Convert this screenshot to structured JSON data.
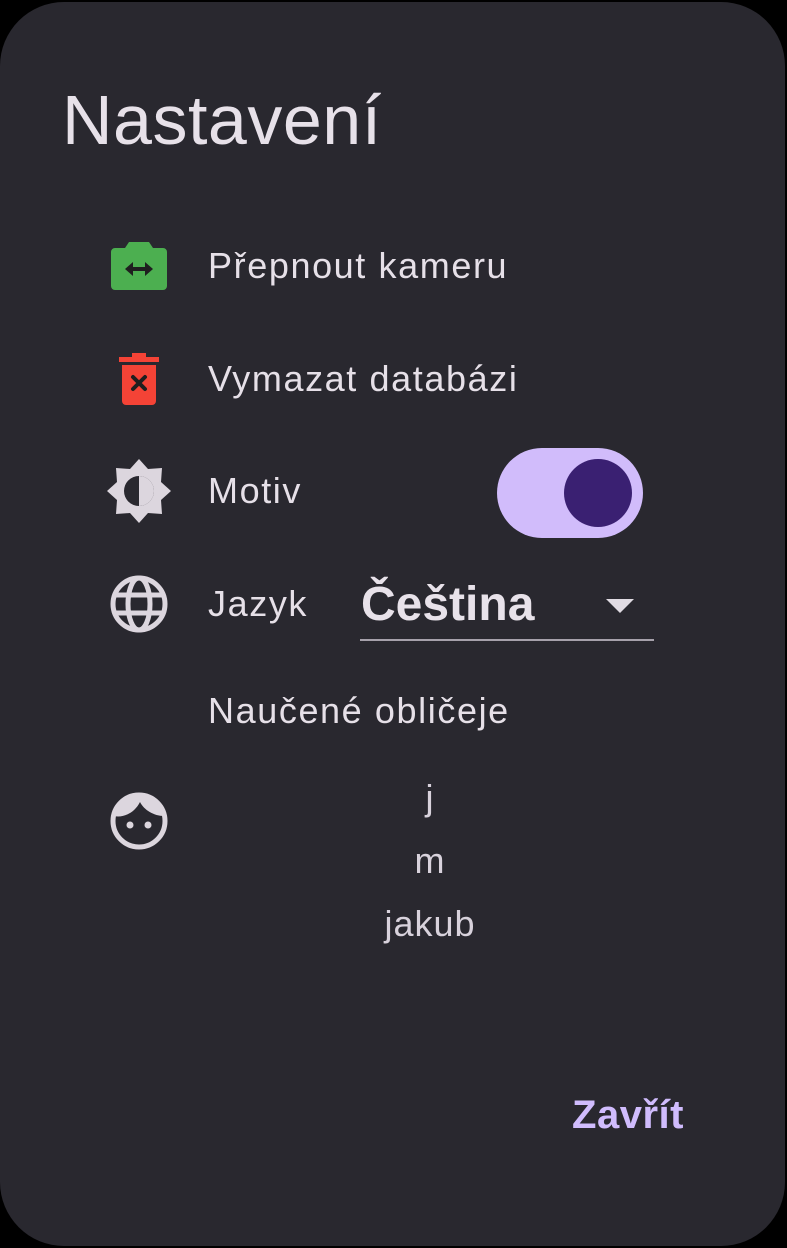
{
  "dialog": {
    "title": "Nastavení",
    "close_label": "Zavřít"
  },
  "settings": {
    "switch_camera": {
      "label": "Přepnout kameru",
      "icon": "camera-switch-icon",
      "icon_color": "#4caf50"
    },
    "clear_database": {
      "label": "Vymazat databázi",
      "icon": "delete-forever-icon",
      "icon_color": "#f44336"
    },
    "theme": {
      "label": "Motiv",
      "icon": "brightness-icon",
      "enabled": true
    },
    "language": {
      "label": "Jazyk",
      "icon": "globe-icon",
      "selected": "Čeština"
    }
  },
  "faces": {
    "label": "Naučené obličeje",
    "icon": "face-icon",
    "items": [
      "j",
      "m",
      "jakub"
    ]
  },
  "colors": {
    "background": "#29282f",
    "accent": "#d1bcfb",
    "accent_dark": "#3a2072",
    "text": "#e6e0e8"
  }
}
